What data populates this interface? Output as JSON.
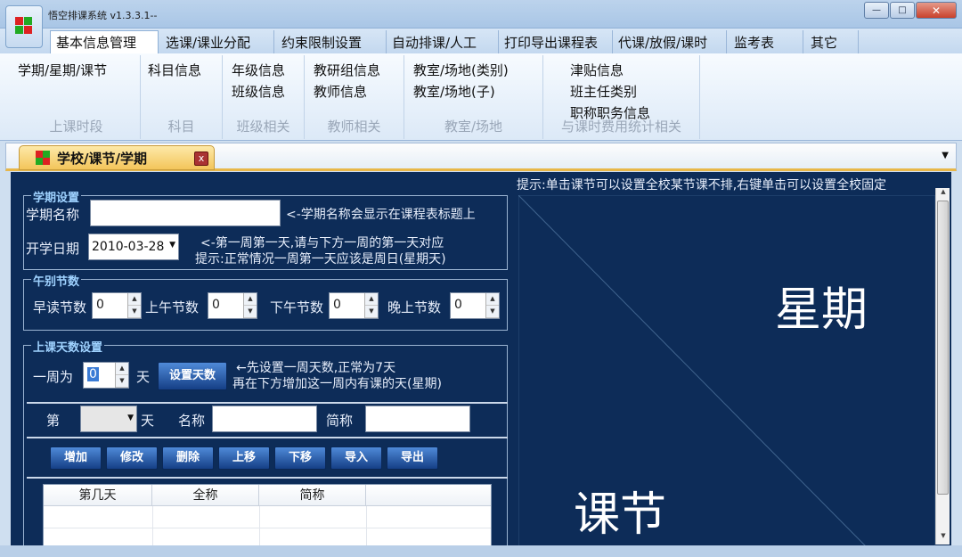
{
  "window": {
    "title": "悟空排课系统 v1.3.3.1--",
    "minimize": "—",
    "maximize": "□",
    "close": "✕"
  },
  "tabs": [
    "基本信息管理",
    "选课/课业分配",
    "约束限制设置",
    "自动排课/人工",
    "打印导出课程表",
    "代课/放假/课时",
    "监考表",
    "其它"
  ],
  "ribbon": {
    "groups": [
      {
        "label": "上课时段",
        "items": [
          "学期/星期/课节"
        ]
      },
      {
        "label": "科目",
        "items": [
          "科目信息"
        ]
      },
      {
        "label": "班级相关",
        "items": [
          "年级信息",
          "班级信息"
        ]
      },
      {
        "label": "教师相关",
        "items": [
          "教研组信息",
          "教师信息"
        ]
      },
      {
        "label": "教室/场地",
        "items": [
          "教室/场地(类别)",
          "教室/场地(子)"
        ]
      },
      {
        "label": "与课时费用统计相关",
        "items": [
          "津贴信息",
          "班主任类别",
          "职称职务信息"
        ]
      }
    ]
  },
  "doc_tab": {
    "label": "学校/课节/学期",
    "close": "x",
    "dropdown": "▼"
  },
  "semester": {
    "legend": "学期设置",
    "name_label": "学期名称",
    "name_value": "",
    "name_note": "<-学期名称会显示在课程表标题上",
    "start_label": "开学日期",
    "start_value": "2010-03-28",
    "start_note1": "<-第一周第一天,请与下方一周的第一天对应",
    "start_note2": "提示:正常情况一周第一天应该是周日(星期天)"
  },
  "periods": {
    "legend": "午别节数",
    "morning_read_label": "早读节数",
    "morning_read": "0",
    "morning_label": "上午节数",
    "morning": "0",
    "afternoon_label": "下午节数",
    "afternoon": "0",
    "evening_label": "晚上节数",
    "evening": "0"
  },
  "days": {
    "legend": "上课天数设置",
    "week_label": "一周为",
    "week_value": "0",
    "day_unit": "天",
    "set_button": "设置天数",
    "note1": "←先设置一周天数,正常为7天",
    "note2": "再在下方增加这一周内有课的天(星期)",
    "nth_label": "第",
    "nth_unit": "天",
    "name_label": "名称",
    "short_label": "简称",
    "buttons": [
      "增加",
      "修改",
      "删除",
      "上移",
      "下移",
      "导入",
      "导出"
    ],
    "columns": [
      "第几天",
      "全称",
      "简称"
    ]
  },
  "preview": {
    "hint": "提示:单击课节可以设置全校某节课不排,右键单击可以设置全校固定",
    "corner_top": "星期",
    "corner_bottom": "课节"
  },
  "colors": {
    "panel_bg": "#0d2c58",
    "legend_text": "#9fd2ff",
    "button_blue": "#1f58b0"
  }
}
